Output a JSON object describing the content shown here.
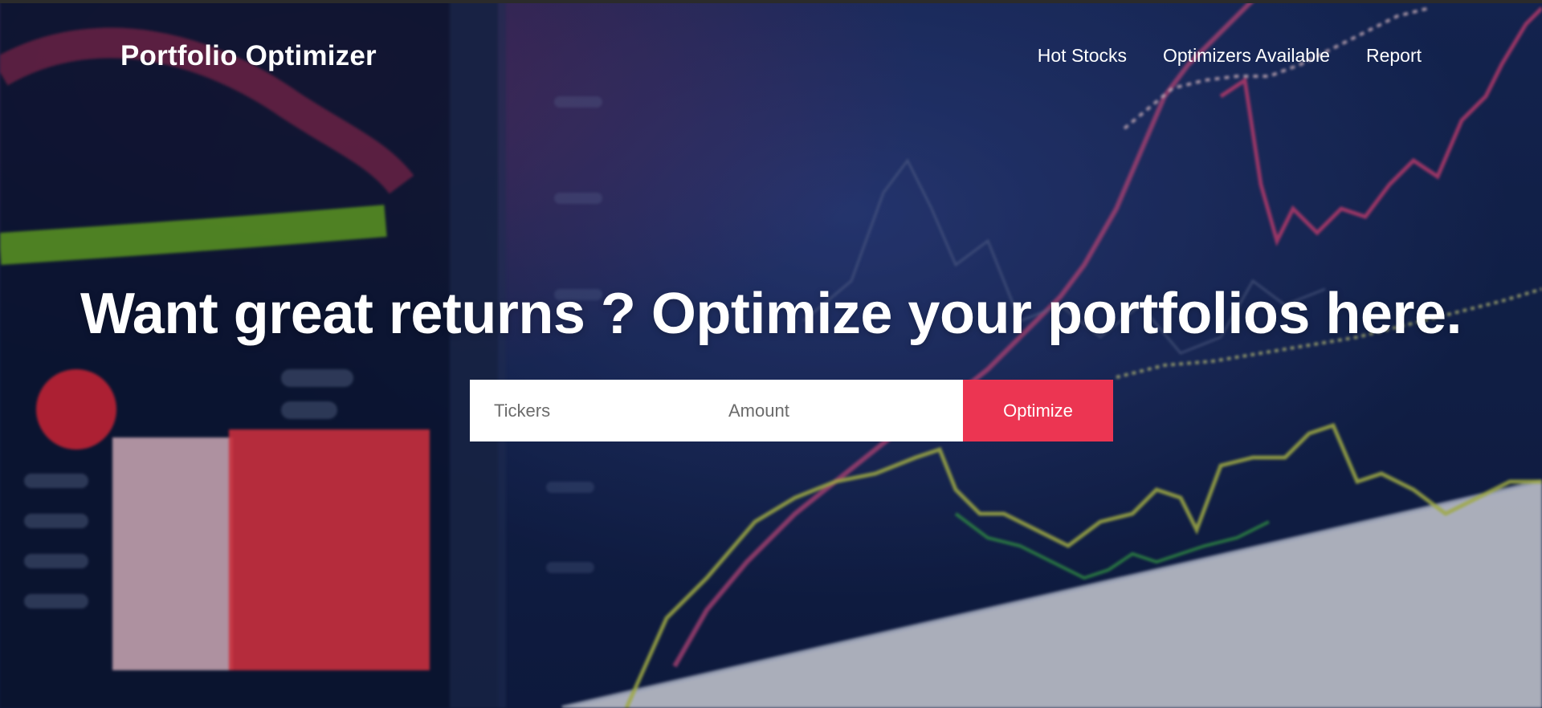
{
  "navbar": {
    "brand": "Portfolio Optimizer",
    "links": [
      {
        "label": "Hot Stocks"
      },
      {
        "label": "Optimizers Available"
      },
      {
        "label": "Report"
      }
    ]
  },
  "hero": {
    "headline": "Want great returns ? Optimize your portfolios here.",
    "form": {
      "tickers_placeholder": "Tickers",
      "amount_placeholder": "Amount",
      "submit_label": "Optimize"
    }
  },
  "colors": {
    "accent": "#ec3552",
    "background": "#13244f",
    "text": "#ffffff"
  }
}
